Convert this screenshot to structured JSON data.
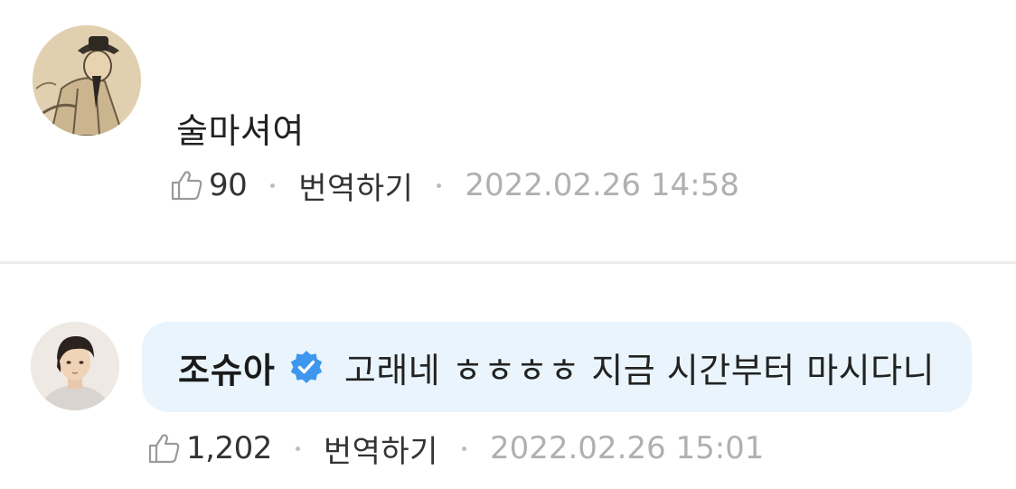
{
  "comments": [
    {
      "avatar_icon": "traditional-painting-avatar",
      "text": "술마셔여",
      "likes": "90",
      "translate_label": "번역하기",
      "timestamp": "2022.02.26 14:58"
    },
    {
      "avatar_icon": "person-photo-avatar",
      "author": "조슈아",
      "verified_icon": "verified-check-badge",
      "text": "고래네 ㅎㅎㅎㅎ 지금 시간부터 마시다니",
      "likes": "1,202",
      "translate_label": "번역하기",
      "timestamp": "2022.02.26 15:01"
    }
  ],
  "colors": {
    "bubble_background": "#e9f4fc",
    "verified_blue": "#3d97ee",
    "timestamp_gray": "#b0b0b0",
    "divider": "#ececec"
  }
}
